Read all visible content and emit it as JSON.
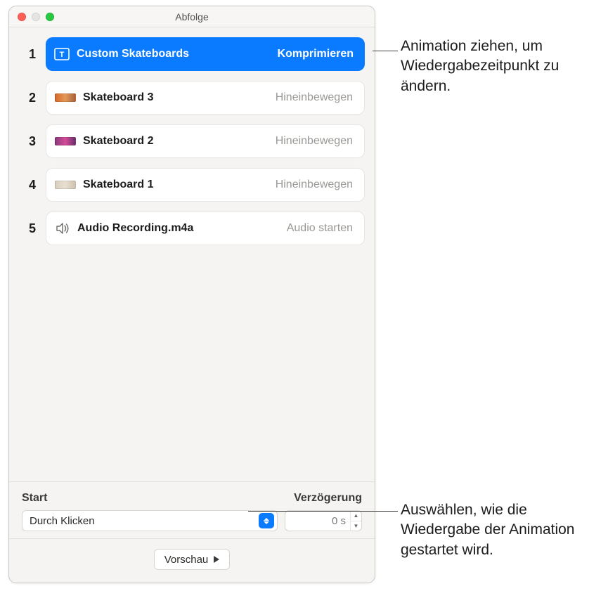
{
  "window": {
    "title": "Abfolge"
  },
  "list": [
    {
      "num": "1",
      "name": "Custom Skateboards",
      "effect": "Komprimieren",
      "selected": true,
      "icon": "text-frame"
    },
    {
      "num": "2",
      "name": "Skateboard 3",
      "effect": "Hineinbewegen",
      "selected": false,
      "icon": "thumb1"
    },
    {
      "num": "3",
      "name": "Skateboard 2",
      "effect": "Hineinbewegen",
      "selected": false,
      "icon": "thumb2"
    },
    {
      "num": "4",
      "name": "Skateboard 1",
      "effect": "Hineinbewegen",
      "selected": false,
      "icon": "thumb3"
    },
    {
      "num": "5",
      "name": "Audio Recording.m4a",
      "effect": "Audio starten",
      "selected": false,
      "icon": "audio"
    }
  ],
  "panel": {
    "start_label": "Start",
    "delay_label": "Verzögerung",
    "start_value": "Durch Klicken",
    "delay_value": "0 s",
    "preview_label": "Vorschau"
  },
  "callouts": {
    "c1": "Animation ziehen, um Wiedergabezeitpunkt zu ändern.",
    "c2": "Auswählen, wie die Wiedergabe der Animation gestartet wird."
  }
}
